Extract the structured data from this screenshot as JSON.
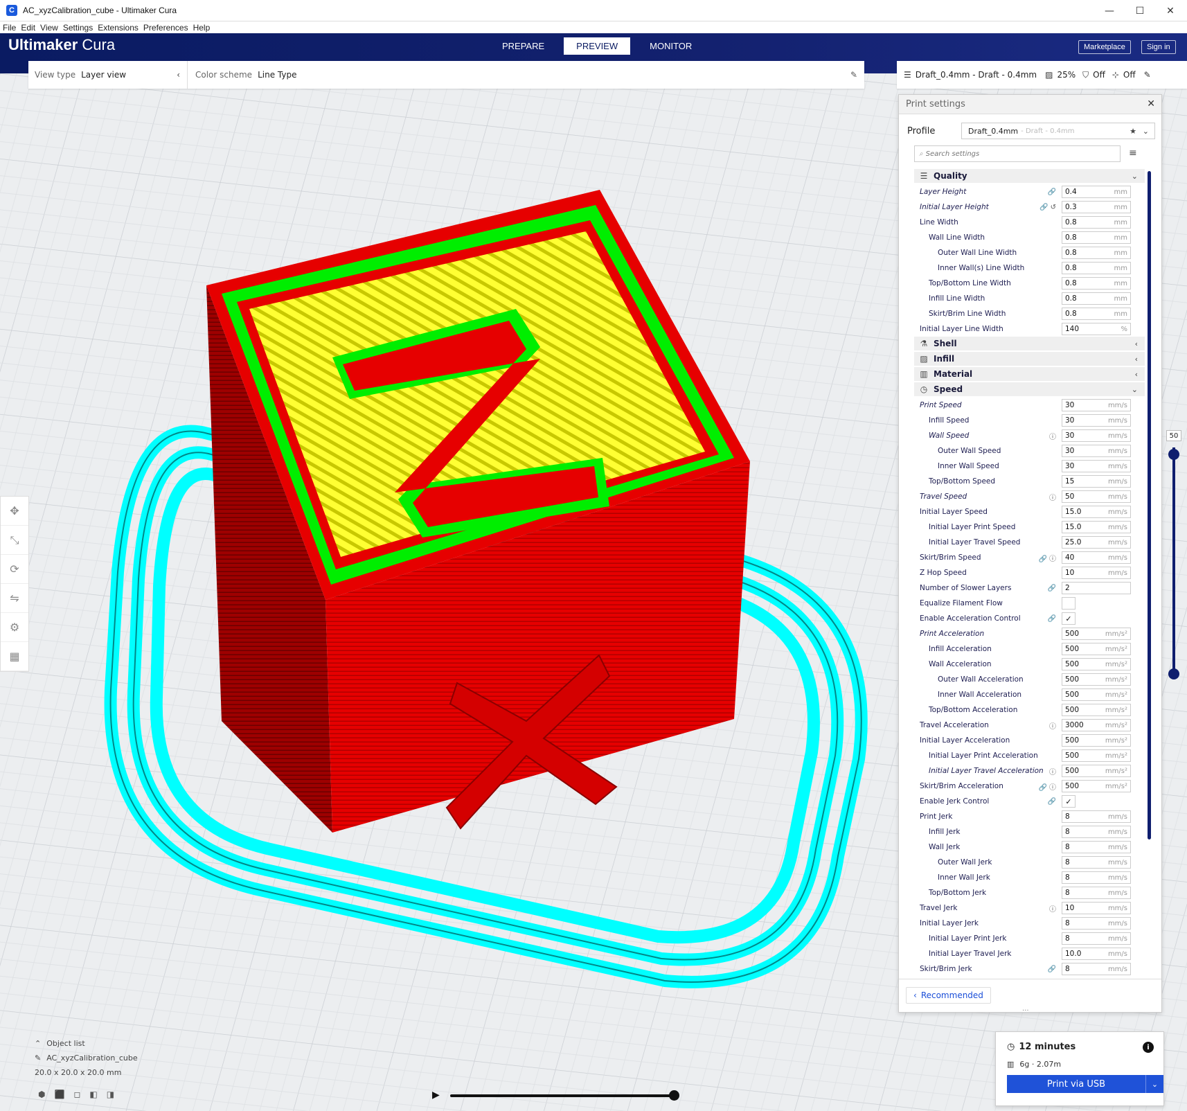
{
  "window": {
    "title": "AC_xyzCalibration_cube - Ultimaker Cura",
    "app_icon": "C",
    "minimize": "—",
    "maximize": "☐",
    "close": "✕"
  },
  "menu": [
    "File",
    "Edit",
    "View",
    "Settings",
    "Extensions",
    "Preferences",
    "Help"
  ],
  "header": {
    "brand_a": "Ultimaker",
    "brand_b": "Cura",
    "stages": [
      "PREPARE",
      "PREVIEW",
      "MONITOR"
    ],
    "active_stage": "PREVIEW",
    "marketplace": "Marketplace",
    "sign_in": "Sign in",
    "bg_color": "#0a1b62"
  },
  "viewbar": {
    "view_type_label": "View type",
    "view_type_value": "Layer view",
    "color_scheme_label": "Color scheme",
    "color_scheme_value": "Line Type"
  },
  "printbar": {
    "profile": "Draft_0.4mm - Draft - 0.4mm",
    "infill": "25%",
    "support": "Off",
    "adhesion": "Off"
  },
  "print_settings": {
    "title": "Print settings",
    "profile_label": "Profile",
    "profile_value": "Draft_0.4mm",
    "profile_sub": "- Draft - 0.4mm",
    "search_placeholder": "Search settings",
    "recommended": "Recommended",
    "categories": [
      {
        "icon": "quality-icon",
        "glyph": "☰",
        "label": "Quality",
        "expanded": true,
        "settings": [
          {
            "label": "Layer Height",
            "italic": true,
            "indent": 0,
            "icons": "🔗",
            "value": "0.4",
            "unit": "mm"
          },
          {
            "label": "Initial Layer Height",
            "italic": true,
            "indent": 0,
            "icons": "🔗↺",
            "value": "0.3",
            "unit": "mm"
          },
          {
            "label": "Line Width",
            "italic": false,
            "indent": 0,
            "icons": "",
            "value": "0.8",
            "unit": "mm"
          },
          {
            "label": "Wall Line Width",
            "italic": false,
            "indent": 1,
            "icons": "",
            "value": "0.8",
            "unit": "mm"
          },
          {
            "label": "Outer Wall Line Width",
            "italic": false,
            "indent": 2,
            "icons": "",
            "value": "0.8",
            "unit": "mm"
          },
          {
            "label": "Inner Wall(s) Line Width",
            "italic": false,
            "indent": 2,
            "icons": "",
            "value": "0.8",
            "unit": "mm"
          },
          {
            "label": "Top/Bottom Line Width",
            "italic": false,
            "indent": 1,
            "icons": "",
            "value": "0.8",
            "unit": "mm"
          },
          {
            "label": "Infill Line Width",
            "italic": false,
            "indent": 1,
            "icons": "",
            "value": "0.8",
            "unit": "mm"
          },
          {
            "label": "Skirt/Brim Line Width",
            "italic": false,
            "indent": 1,
            "icons": "",
            "value": "0.8",
            "unit": "mm"
          },
          {
            "label": "Initial Layer Line Width",
            "italic": false,
            "indent": 0,
            "icons": "",
            "value": "140",
            "unit": "%"
          }
        ]
      },
      {
        "icon": "shell-icon",
        "glyph": "⚗",
        "label": "Shell",
        "expanded": false,
        "settings": []
      },
      {
        "icon": "infill-icon",
        "glyph": "▨",
        "label": "Infill",
        "expanded": false,
        "settings": []
      },
      {
        "icon": "material-icon",
        "glyph": "▥",
        "label": "Material",
        "expanded": false,
        "settings": []
      },
      {
        "icon": "speed-icon",
        "glyph": "◷",
        "label": "Speed",
        "expanded": true,
        "settings": [
          {
            "label": "Print Speed",
            "italic": true,
            "indent": 0,
            "icons": "",
            "value": "30",
            "unit": "mm/s"
          },
          {
            "label": "Infill Speed",
            "italic": false,
            "indent": 1,
            "icons": "",
            "value": "30",
            "unit": "mm/s"
          },
          {
            "label": "Wall Speed",
            "italic": true,
            "indent": 1,
            "icons": "ⓘ",
            "value": "30",
            "unit": "mm/s"
          },
          {
            "label": "Outer Wall Speed",
            "italic": false,
            "indent": 2,
            "icons": "",
            "value": "30",
            "unit": "mm/s"
          },
          {
            "label": "Inner Wall Speed",
            "italic": false,
            "indent": 2,
            "icons": "",
            "value": "30",
            "unit": "mm/s"
          },
          {
            "label": "Top/Bottom Speed",
            "italic": false,
            "indent": 1,
            "icons": "",
            "value": "15",
            "unit": "mm/s"
          },
          {
            "label": "Travel Speed",
            "italic": true,
            "indent": 0,
            "icons": "ⓘ",
            "value": "50",
            "unit": "mm/s"
          },
          {
            "label": "Initial Layer Speed",
            "italic": false,
            "indent": 0,
            "icons": "",
            "value": "15.0",
            "unit": "mm/s"
          },
          {
            "label": "Initial Layer Print Speed",
            "italic": false,
            "indent": 1,
            "icons": "",
            "value": "15.0",
            "unit": "mm/s"
          },
          {
            "label": "Initial Layer Travel Speed",
            "italic": false,
            "indent": 1,
            "icons": "",
            "value": "25.0",
            "unit": "mm/s"
          },
          {
            "label": "Skirt/Brim Speed",
            "italic": false,
            "indent": 0,
            "icons": "🔗ⓘ",
            "value": "40",
            "unit": "mm/s"
          },
          {
            "label": "Z Hop Speed",
            "italic": false,
            "indent": 0,
            "icons": "",
            "value": "10",
            "unit": "mm/s"
          },
          {
            "label": "Number of Slower Layers",
            "italic": false,
            "indent": 0,
            "icons": "🔗",
            "value": "2",
            "unit": ""
          },
          {
            "label": "Equalize Filament Flow",
            "italic": false,
            "indent": 0,
            "icons": "",
            "check": ""
          },
          {
            "label": "Enable Acceleration Control",
            "italic": false,
            "indent": 0,
            "icons": "🔗",
            "check": "✓"
          },
          {
            "label": "Print Acceleration",
            "italic": true,
            "indent": 0,
            "icons": "",
            "value": "500",
            "unit": "mm/s²"
          },
          {
            "label": "Infill Acceleration",
            "italic": false,
            "indent": 1,
            "icons": "",
            "value": "500",
            "unit": "mm/s²"
          },
          {
            "label": "Wall Acceleration",
            "italic": false,
            "indent": 1,
            "icons": "",
            "value": "500",
            "unit": "mm/s²"
          },
          {
            "label": "Outer Wall Acceleration",
            "italic": false,
            "indent": 2,
            "icons": "",
            "value": "500",
            "unit": "mm/s²"
          },
          {
            "label": "Inner Wall Acceleration",
            "italic": false,
            "indent": 2,
            "icons": "",
            "value": "500",
            "unit": "mm/s²"
          },
          {
            "label": "Top/Bottom Acceleration",
            "italic": false,
            "indent": 1,
            "icons": "",
            "value": "500",
            "unit": "mm/s²"
          },
          {
            "label": "Travel Acceleration",
            "italic": false,
            "indent": 0,
            "icons": "ⓘ",
            "value": "3000",
            "unit": "mm/s²"
          },
          {
            "label": "Initial Layer Acceleration",
            "italic": false,
            "indent": 0,
            "icons": "",
            "value": "500",
            "unit": "mm/s²"
          },
          {
            "label": "Initial Layer Print Acceleration",
            "italic": false,
            "indent": 1,
            "icons": "",
            "value": "500",
            "unit": "mm/s²"
          },
          {
            "label": "Initial Layer Travel Acceleration",
            "italic": true,
            "indent": 1,
            "icons": "ⓘ",
            "value": "500",
            "unit": "mm/s²"
          },
          {
            "label": "Skirt/Brim Acceleration",
            "italic": false,
            "indent": 0,
            "icons": "🔗ⓘ",
            "value": "500",
            "unit": "mm/s²"
          },
          {
            "label": "Enable Jerk Control",
            "italic": false,
            "indent": 0,
            "icons": "🔗",
            "check": "✓"
          },
          {
            "label": "Print Jerk",
            "italic": false,
            "indent": 0,
            "icons": "",
            "value": "8",
            "unit": "mm/s"
          },
          {
            "label": "Infill Jerk",
            "italic": false,
            "indent": 1,
            "icons": "",
            "value": "8",
            "unit": "mm/s"
          },
          {
            "label": "Wall Jerk",
            "italic": false,
            "indent": 1,
            "icons": "",
            "value": "8",
            "unit": "mm/s"
          },
          {
            "label": "Outer Wall Jerk",
            "italic": false,
            "indent": 2,
            "icons": "",
            "value": "8",
            "unit": "mm/s"
          },
          {
            "label": "Inner Wall Jerk",
            "italic": false,
            "indent": 2,
            "icons": "",
            "value": "8",
            "unit": "mm/s"
          },
          {
            "label": "Top/Bottom Jerk",
            "italic": false,
            "indent": 1,
            "icons": "",
            "value": "8",
            "unit": "mm/s"
          },
          {
            "label": "Travel Jerk",
            "italic": false,
            "indent": 0,
            "icons": "ⓘ",
            "value": "10",
            "unit": "mm/s"
          },
          {
            "label": "Initial Layer Jerk",
            "italic": false,
            "indent": 0,
            "icons": "",
            "value": "8",
            "unit": "mm/s"
          },
          {
            "label": "Initial Layer Print Jerk",
            "italic": false,
            "indent": 1,
            "icons": "",
            "value": "8",
            "unit": "mm/s"
          },
          {
            "label": "Initial Layer Travel Jerk",
            "italic": false,
            "indent": 1,
            "icons": "",
            "value": "10.0",
            "unit": "mm/s"
          },
          {
            "label": "Skirt/Brim Jerk",
            "italic": false,
            "indent": 0,
            "icons": "🔗",
            "value": "8",
            "unit": "mm/s"
          }
        ]
      }
    ]
  },
  "layer_slider": {
    "value": "50",
    "level": 1.0
  },
  "object": {
    "list_label": "Object list",
    "name": "AC_xyzCalibration_cube",
    "dimensions": "20.0 x 20.0 x 20.0 mm"
  },
  "playback": {
    "progress": 1.0
  },
  "job": {
    "time": "12 minutes",
    "weight": "6g",
    "length": "2.07m",
    "material": "6g · 2.07m",
    "button": "Print via USB"
  },
  "colors": {
    "accent": "#1f52d8",
    "outer_wall": "#ff0000",
    "inner_wall": "#00ff00",
    "top_bottom": "#ffff00",
    "skirt": "#00ffff",
    "dark_blue": "#0f1e6e"
  }
}
